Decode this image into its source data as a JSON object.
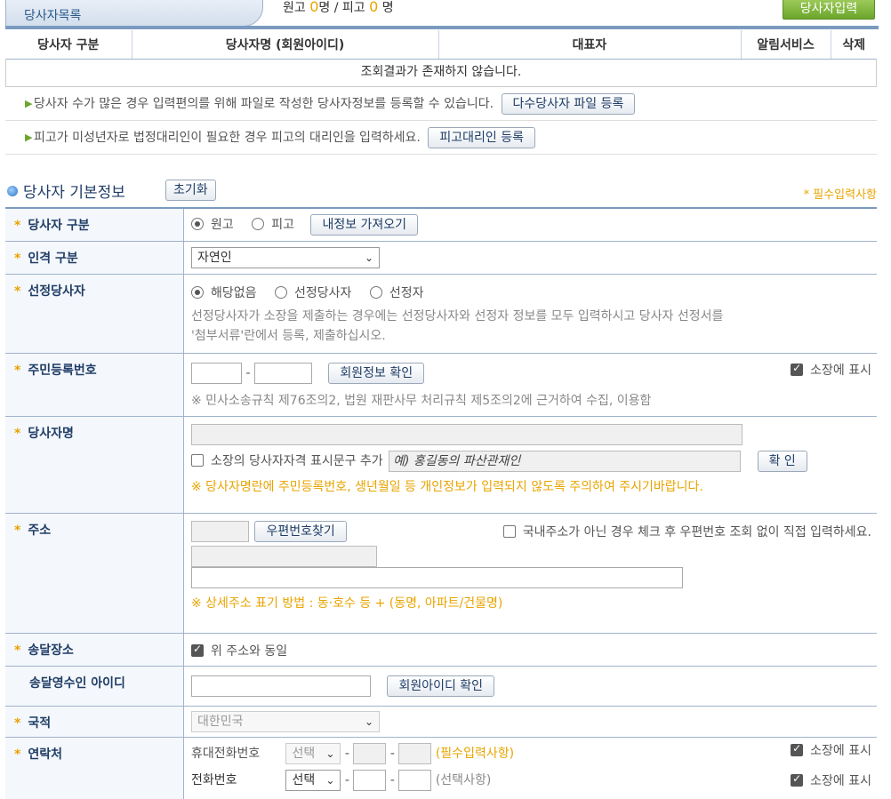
{
  "tabs": {
    "party_list": "당사자목록"
  },
  "counts": {
    "plaintiff_label": "원고",
    "plaintiff_count": "0",
    "plaintiff_unit": "명",
    "sep": "/",
    "defendant_label": "피고",
    "defendant_count": "0",
    "defendant_unit": "명"
  },
  "buttons": {
    "party_input": "당사자입력",
    "multi_file": "다수당사자 파일 등록",
    "defendant_agent": "피고대리인 등록",
    "reset": "초기화",
    "load_my_info": "내정보 가져오기",
    "member_check": "회원정보 확인",
    "confirm": "확 인",
    "postal_search": "우편번호찾기",
    "member_id_check": "회원아이디 확인"
  },
  "table": {
    "headers": [
      "당사자 구분",
      "당사자명 (회원아이디)",
      "대표자",
      "알림서비스",
      "삭제"
    ],
    "empty": "조회결과가 존재하지 않습니다."
  },
  "info": {
    "multi": "당사자 수가 많은 경우 입력편의를 위해 파일로 작성한 당사자정보를 등록할 수 있습니다.",
    "minor": "피고가 미성년자로 법정대리인이 필요한 경우 피고의 대리인을 입력하세요."
  },
  "section": {
    "title": "당사자 기본정보",
    "required_note": "* 필수입력사항",
    "star": "*"
  },
  "form": {
    "party_type": {
      "label": "당사자 구분",
      "opt1": "원고",
      "opt2": "피고"
    },
    "person_type": {
      "label": "인격 구분",
      "value": "자연인"
    },
    "selected_party": {
      "label": "선정당사자",
      "opt1": "해당없음",
      "opt2": "선정당사자",
      "opt3": "선정자",
      "desc1": "선정당사자가 소장을 제출하는 경우에는 선정당사자와 선정자 정보를 모두 입력하시고 당사자 선정서를",
      "desc2": "'첨부서류'란에서 등록, 제출하십시오."
    },
    "rrn": {
      "label": "주민등록번호",
      "dash": "-",
      "show_label": "소장에 표시",
      "note": "※ 민사소송규칙 제76조의2, 법원 재판사무 처리규칙 제5조의2에 근거하여 수집, 이용함"
    },
    "party_name": {
      "label": "당사자명",
      "qual_label": "소장의 당사자자격 표시문구 추가",
      "qual_placeholder": "예) 홍길동의 파산관재인",
      "warn": "※ 당사자명란에 주민등록번호, 생년월일 등 개인정보가 입력되지 않도록 주의하여 주시기바랍니다."
    },
    "address": {
      "label": "주소",
      "foreign_label": "국내주소가 아닌 경우 체크 후 우편번호 조회 없이 직접 입력하세요.",
      "note": "※ 상세주소 표기 방법 : 동·호수 등 + (동명, 아파트/건물명)"
    },
    "delivery": {
      "label": "송달장소",
      "same_label": "위 주소와 동일"
    },
    "recipient_id": {
      "label": "송달영수인 아이디"
    },
    "nationality": {
      "label": "국적",
      "value": "대한민국"
    },
    "contact": {
      "label": "연락처",
      "mobile_label": "휴대전화번호",
      "mobile_select": "선택",
      "mobile_note": "(필수입력사항)",
      "phone_label": "전화번호",
      "phone_select": "선택",
      "phone_note": "(선택사항)",
      "dash": "-",
      "show_label": "소장에 표시"
    }
  }
}
